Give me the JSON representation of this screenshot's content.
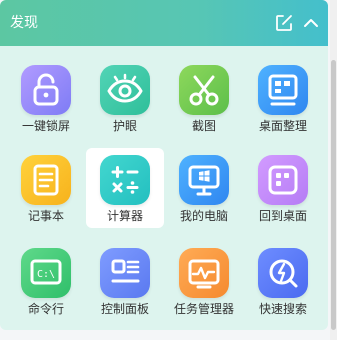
{
  "header": {
    "title": "发现",
    "edit_icon": "edit-icon",
    "collapse_icon": "chevron-up-icon"
  },
  "colors": {
    "header_start": "#5cc7a2",
    "header_end": "#44bfcc",
    "panel_bg": "#ddf4ee"
  },
  "tools": [
    {
      "label": "一键锁屏",
      "icon": "lock-icon"
    },
    {
      "label": "护眼",
      "icon": "eye-icon"
    },
    {
      "label": "截图",
      "icon": "scissors-icon"
    },
    {
      "label": "桌面整理",
      "icon": "desktop-organize-icon"
    },
    {
      "label": "记事本",
      "icon": "notepad-icon"
    },
    {
      "label": "计算器",
      "icon": "calculator-icon",
      "selected": true
    },
    {
      "label": "我的电脑",
      "icon": "computer-icon"
    },
    {
      "label": "回到桌面",
      "icon": "show-desktop-icon"
    },
    {
      "label": "命令行",
      "icon": "terminal-icon"
    },
    {
      "label": "控制面板",
      "icon": "control-panel-icon"
    },
    {
      "label": "任务管理器",
      "icon": "task-manager-icon"
    },
    {
      "label": "快速搜索",
      "icon": "quick-search-icon"
    }
  ]
}
